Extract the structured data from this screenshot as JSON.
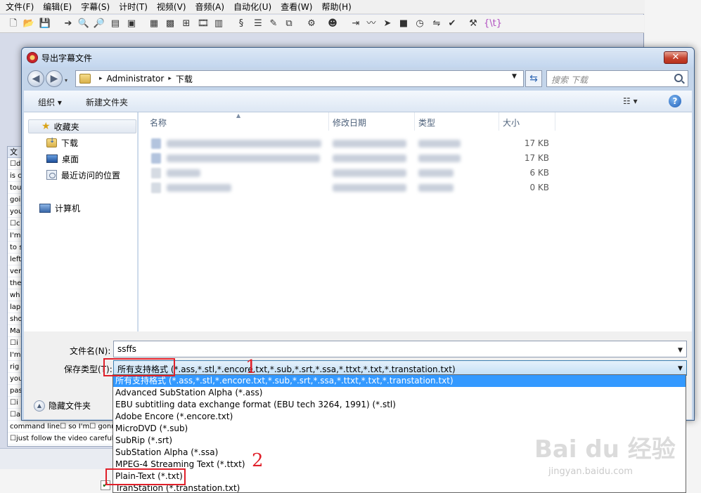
{
  "background_app": {
    "menu": [
      "文件(F)",
      "编辑(E)",
      "字幕(S)",
      "计时(T)",
      "视频(V)",
      "音频(A)",
      "自动化(U)",
      "查看(W)",
      "帮助(H)"
    ],
    "subtitle_header": "文",
    "subtitle_rows": [
      "☐d",
      "is c",
      "tou",
      "goi",
      "you",
      "☐c",
      "I'm",
      "to s",
      "left",
      "ver",
      "the",
      "wh",
      "lap",
      "sho",
      "Ma",
      "☐i",
      "I'm",
      "rig",
      "you",
      "pas",
      "☐i",
      "☐a",
      "command line☐ so I'm☐ gonna",
      "☐just follow the video carefull"
    ]
  },
  "dialog": {
    "title": "导出字幕文件",
    "close_glyph": "✕",
    "breadcrumb": [
      "Administrator",
      "下载"
    ],
    "search_placeholder": "搜索 下载",
    "commands": {
      "organize": "组织 ▾",
      "new_folder": "新建文件夹",
      "view": "☷ ▾",
      "help": "?"
    },
    "nav": {
      "favorites": "收藏夹",
      "downloads": "下载",
      "desktop": "桌面",
      "recent": "最近访问的位置",
      "computer": "计算机"
    },
    "columns": {
      "name": "名称",
      "modified": "修改日期",
      "type": "类型",
      "size": "大小"
    },
    "file_sizes": [
      "17 KB",
      "17 KB",
      "6 KB",
      "0 KB"
    ],
    "filename_label": "文件名(N):",
    "filename_value": "ssffs",
    "filetype_label": "保存类型(T):",
    "filetype_value": "所有支持格式 (*.ass,*.stl,*.encore.txt,*.sub,*.srt,*.ssa,*.ttxt,*.txt,*.transtation.txt)",
    "hide_folders": "隐藏文件夹"
  },
  "dropdown_options": [
    "所有支持格式 (*.ass,*.stl,*.encore.txt,*.sub,*.srt,*.ssa,*.ttxt,*.txt,*.transtation.txt)",
    "Advanced SubStation Alpha (*.ass)",
    "EBU subtitling data exchange format (EBU tech 3264, 1991) (*.stl)",
    "Adobe Encore (*.encore.txt)",
    "MicroDVD (*.sub)",
    "SubRip (*.srt)",
    "SubStation Alpha (*.ssa)",
    "MPEG-4 Streaming Text (*.ttxt)",
    "Plain-Text (*.txt)",
    "TranStation (*.transtation.txt)"
  ],
  "annotations": {
    "mark1": "1",
    "mark2": "2"
  },
  "watermark": {
    "brand": "Bai du 经验",
    "url": "jingyan.baidu.com"
  },
  "colors": {
    "accent": "#3399ff",
    "annotation": "#e0202a",
    "close": "#c5432f"
  }
}
